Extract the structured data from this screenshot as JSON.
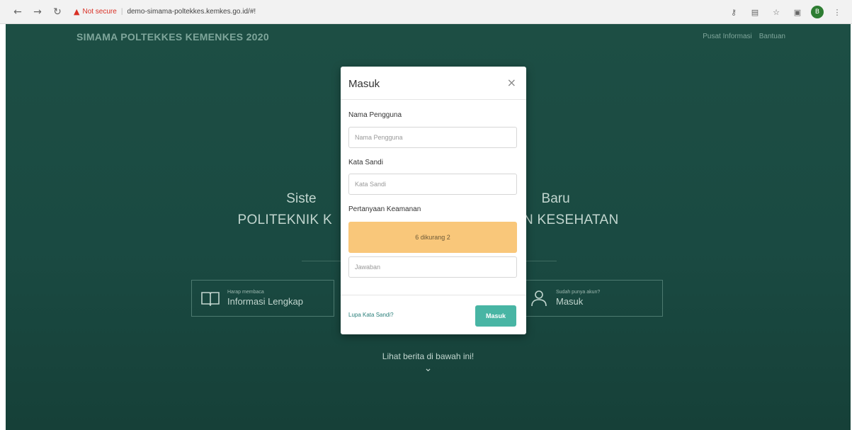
{
  "browser": {
    "back_icon": "arrow-left-icon",
    "forward_icon": "arrow-right-icon",
    "reload_icon": "reload-icon",
    "security_label": "Not secure",
    "url": "demo-simama-poltekkes.kemkes.go.id/#!",
    "profile_initial": "B"
  },
  "page": {
    "brand": "SIMAMA POLTEKKES KEMENKES 2020",
    "top_links": [
      "Pusat Informasi",
      "Bantuan"
    ],
    "hero_line1_left": "Siste",
    "hero_line1_right": "Baru",
    "hero_line2_left": "POLITEKNIK K",
    "hero_line2_right": "N KESEHATAN",
    "cards": [
      {
        "small": "Harap membaca",
        "big": "Informasi Lengkap",
        "icon": "book-icon"
      },
      {
        "small": "Sudah punya akun?",
        "big": "Masuk",
        "icon": "user-icon"
      }
    ],
    "news_text": "Lihat berita di bawah ini!",
    "news_icon": "chevron-down-icon"
  },
  "modal": {
    "title": "Masuk",
    "close_icon": "close-icon",
    "username_label": "Nama Pengguna",
    "username_placeholder": "Nama Pengguna",
    "password_label": "Kata Sandi",
    "password_placeholder": "Kata Sandi",
    "security_question_label": "Pertanyaan Keamanan",
    "security_question": "6 dikurang 2",
    "answer_placeholder": "Jawaban",
    "forgot_link": "Lupa Kata Sandi?",
    "submit_label": "Masuk"
  },
  "colors": {
    "background": "#1a4a42",
    "captcha": "#f9c77a",
    "submit": "#48b5a4"
  }
}
